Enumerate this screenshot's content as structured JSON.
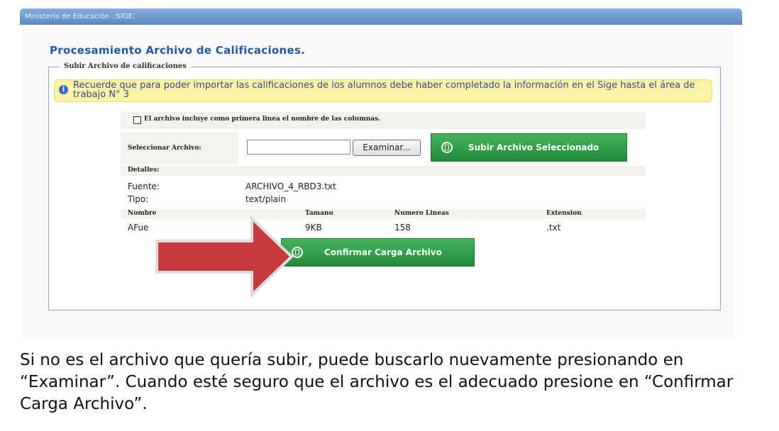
{
  "header": {
    "app_title": "Ministerio de Educación .:SIGE."
  },
  "page": {
    "title": "Procesamiento Archivo de Calificaciones."
  },
  "fieldset": {
    "legend": "Subir Archivo de calificaciones"
  },
  "info": {
    "text": "Recuerde que para poder importar las calificaciones de los alumnos debe haber completado la información en el Sige hasta el área de trabajo N° 3"
  },
  "form": {
    "header_checkbox_label": "El archivo incluye como primera linea el nombre de las columnas.",
    "header_checkbox_checked": false,
    "select_file_label": "Seleccionar Archivo:",
    "file_input_value": "",
    "browse_label": "Examinar...",
    "upload_selected_label": "Subir Archivo Seleccionado"
  },
  "details": {
    "heading": "Detalles:",
    "source_label": "Fuente:",
    "source_value": "ARCHIVO_4_RBD3.txt",
    "type_label": "Tipo:",
    "type_value": "text/plain",
    "columns": [
      "Nombre",
      "Tamano",
      "Numero Lineas",
      "Extension"
    ],
    "row": [
      "AFue",
      "9KB",
      "158",
      ".txt"
    ]
  },
  "confirm": {
    "label": "Confirmar Carga Archivo"
  },
  "instruction": {
    "text": "Si no es el archivo que quería subir, puede buscarlo nuevamente presionando en “Examinar”. Cuando esté seguro que el archivo es el adecuado presione en “Confirmar Carga Archivo”."
  },
  "colors": {
    "header_bar": "#6e98cc",
    "title": "#1f58a8",
    "info_bg": "#fff3a5",
    "green_button": "#2a9a44",
    "arrow": "#c63b3b"
  },
  "icons": [
    "info-icon",
    "save-disk-icon",
    "arrow-pointer"
  ]
}
